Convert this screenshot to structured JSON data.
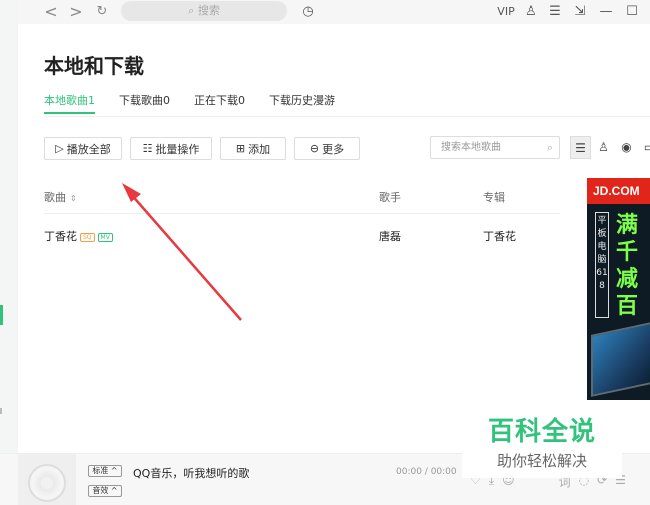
{
  "topbar": {
    "back": "<",
    "forward": ">",
    "refresh": "↻",
    "search_placeholder": "搜索",
    "vip": "VIP",
    "icons": [
      "back-icon",
      "forward-icon",
      "refresh-icon",
      "search-icon",
      "speed-icon",
      "shirt-icon",
      "menu-icon",
      "mini-mode-icon",
      "minimize-icon",
      "maximize-icon"
    ]
  },
  "page": {
    "title": "本地和下载",
    "tabs": [
      {
        "label": "本地歌曲1",
        "active": true
      },
      {
        "label": "下载歌曲0",
        "active": false
      },
      {
        "label": "正在下载0",
        "active": false
      },
      {
        "label": "下载历史漫游",
        "active": false
      }
    ]
  },
  "toolbar": {
    "play_all": "播放全部",
    "batch": "批量操作",
    "add": "添加",
    "more": "更多",
    "search_placeholder": "搜索本地歌曲"
  },
  "table": {
    "headers": {
      "song": "歌曲",
      "artist": "歌手",
      "album": "专辑"
    },
    "rows": [
      {
        "song": "丁香花",
        "badge_sq": "SQ",
        "badge_mv": "MV",
        "artist": "唐磊",
        "album": "丁香花"
      }
    ]
  },
  "ad": {
    "brand": "JD.COM",
    "side_text": "平板电脑618",
    "headline": "满千减百"
  },
  "player": {
    "quality": "标准",
    "effect": "音效",
    "song_text": "QQ音乐，听我想听的歌",
    "time": "00:00 / 00:00"
  },
  "watermark": {
    "line1": "百科全说",
    "line2": "助你轻松解决"
  },
  "colors": {
    "accent": "#31c27c",
    "ad_red": "#e1251b",
    "ad_green": "#7dff4a",
    "arrow": "#e8393f"
  }
}
